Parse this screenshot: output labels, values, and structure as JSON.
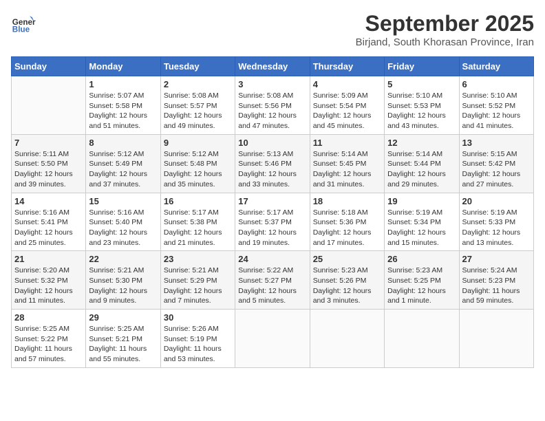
{
  "header": {
    "logo_line1": "General",
    "logo_line2": "Blue",
    "month": "September 2025",
    "location": "Birjand, South Khorasan Province, Iran"
  },
  "weekdays": [
    "Sunday",
    "Monday",
    "Tuesday",
    "Wednesday",
    "Thursday",
    "Friday",
    "Saturday"
  ],
  "weeks": [
    [
      {
        "day": "",
        "info": ""
      },
      {
        "day": "1",
        "info": "Sunrise: 5:07 AM\nSunset: 5:58 PM\nDaylight: 12 hours\nand 51 minutes."
      },
      {
        "day": "2",
        "info": "Sunrise: 5:08 AM\nSunset: 5:57 PM\nDaylight: 12 hours\nand 49 minutes."
      },
      {
        "day": "3",
        "info": "Sunrise: 5:08 AM\nSunset: 5:56 PM\nDaylight: 12 hours\nand 47 minutes."
      },
      {
        "day": "4",
        "info": "Sunrise: 5:09 AM\nSunset: 5:54 PM\nDaylight: 12 hours\nand 45 minutes."
      },
      {
        "day": "5",
        "info": "Sunrise: 5:10 AM\nSunset: 5:53 PM\nDaylight: 12 hours\nand 43 minutes."
      },
      {
        "day": "6",
        "info": "Sunrise: 5:10 AM\nSunset: 5:52 PM\nDaylight: 12 hours\nand 41 minutes."
      }
    ],
    [
      {
        "day": "7",
        "info": "Sunrise: 5:11 AM\nSunset: 5:50 PM\nDaylight: 12 hours\nand 39 minutes."
      },
      {
        "day": "8",
        "info": "Sunrise: 5:12 AM\nSunset: 5:49 PM\nDaylight: 12 hours\nand 37 minutes."
      },
      {
        "day": "9",
        "info": "Sunrise: 5:12 AM\nSunset: 5:48 PM\nDaylight: 12 hours\nand 35 minutes."
      },
      {
        "day": "10",
        "info": "Sunrise: 5:13 AM\nSunset: 5:46 PM\nDaylight: 12 hours\nand 33 minutes."
      },
      {
        "day": "11",
        "info": "Sunrise: 5:14 AM\nSunset: 5:45 PM\nDaylight: 12 hours\nand 31 minutes."
      },
      {
        "day": "12",
        "info": "Sunrise: 5:14 AM\nSunset: 5:44 PM\nDaylight: 12 hours\nand 29 minutes."
      },
      {
        "day": "13",
        "info": "Sunrise: 5:15 AM\nSunset: 5:42 PM\nDaylight: 12 hours\nand 27 minutes."
      }
    ],
    [
      {
        "day": "14",
        "info": "Sunrise: 5:16 AM\nSunset: 5:41 PM\nDaylight: 12 hours\nand 25 minutes."
      },
      {
        "day": "15",
        "info": "Sunrise: 5:16 AM\nSunset: 5:40 PM\nDaylight: 12 hours\nand 23 minutes."
      },
      {
        "day": "16",
        "info": "Sunrise: 5:17 AM\nSunset: 5:38 PM\nDaylight: 12 hours\nand 21 minutes."
      },
      {
        "day": "17",
        "info": "Sunrise: 5:17 AM\nSunset: 5:37 PM\nDaylight: 12 hours\nand 19 minutes."
      },
      {
        "day": "18",
        "info": "Sunrise: 5:18 AM\nSunset: 5:36 PM\nDaylight: 12 hours\nand 17 minutes."
      },
      {
        "day": "19",
        "info": "Sunrise: 5:19 AM\nSunset: 5:34 PM\nDaylight: 12 hours\nand 15 minutes."
      },
      {
        "day": "20",
        "info": "Sunrise: 5:19 AM\nSunset: 5:33 PM\nDaylight: 12 hours\nand 13 minutes."
      }
    ],
    [
      {
        "day": "21",
        "info": "Sunrise: 5:20 AM\nSunset: 5:32 PM\nDaylight: 12 hours\nand 11 minutes."
      },
      {
        "day": "22",
        "info": "Sunrise: 5:21 AM\nSunset: 5:30 PM\nDaylight: 12 hours\nand 9 minutes."
      },
      {
        "day": "23",
        "info": "Sunrise: 5:21 AM\nSunset: 5:29 PM\nDaylight: 12 hours\nand 7 minutes."
      },
      {
        "day": "24",
        "info": "Sunrise: 5:22 AM\nSunset: 5:27 PM\nDaylight: 12 hours\nand 5 minutes."
      },
      {
        "day": "25",
        "info": "Sunrise: 5:23 AM\nSunset: 5:26 PM\nDaylight: 12 hours\nand 3 minutes."
      },
      {
        "day": "26",
        "info": "Sunrise: 5:23 AM\nSunset: 5:25 PM\nDaylight: 12 hours\nand 1 minute."
      },
      {
        "day": "27",
        "info": "Sunrise: 5:24 AM\nSunset: 5:23 PM\nDaylight: 11 hours\nand 59 minutes."
      }
    ],
    [
      {
        "day": "28",
        "info": "Sunrise: 5:25 AM\nSunset: 5:22 PM\nDaylight: 11 hours\nand 57 minutes."
      },
      {
        "day": "29",
        "info": "Sunrise: 5:25 AM\nSunset: 5:21 PM\nDaylight: 11 hours\nand 55 minutes."
      },
      {
        "day": "30",
        "info": "Sunrise: 5:26 AM\nSunset: 5:19 PM\nDaylight: 11 hours\nand 53 minutes."
      },
      {
        "day": "",
        "info": ""
      },
      {
        "day": "",
        "info": ""
      },
      {
        "day": "",
        "info": ""
      },
      {
        "day": "",
        "info": ""
      }
    ]
  ]
}
